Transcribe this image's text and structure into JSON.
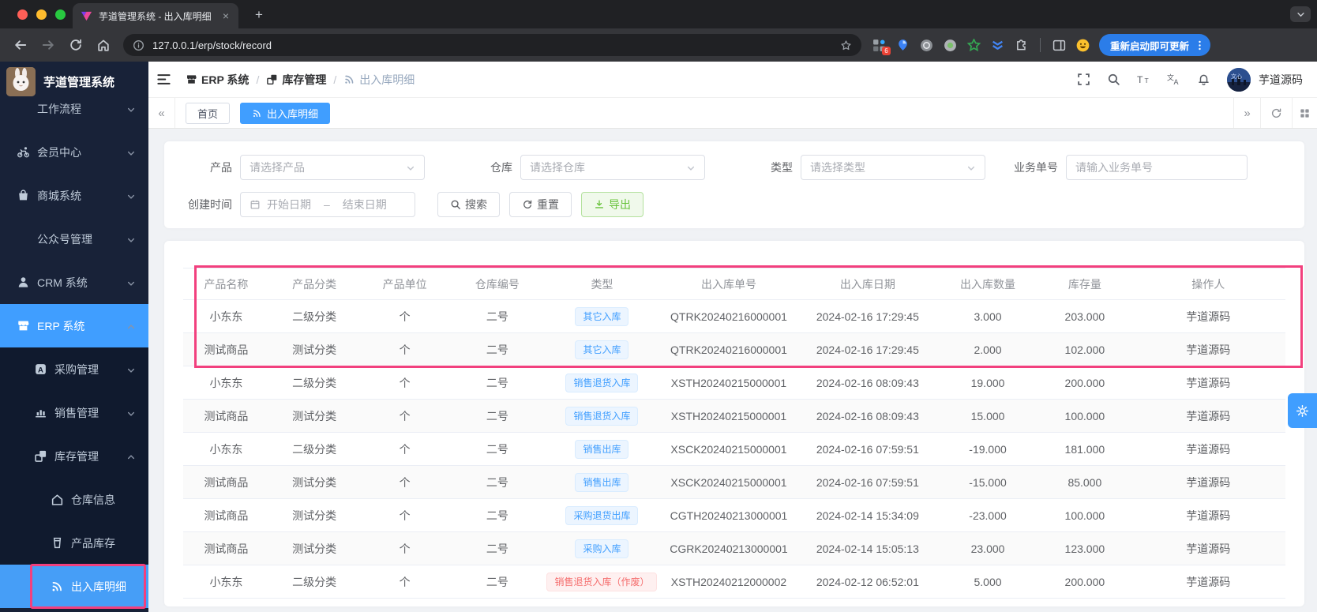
{
  "browser": {
    "tab_title": "芋道管理系统 - 出入库明细",
    "url": "127.0.0.1/erp/stock/record",
    "update_button": "重新启动即可更新",
    "extension_badge": "6"
  },
  "sidebar": {
    "app_title": "芋道管理系统",
    "items": [
      {
        "id": "workflow",
        "label": "工作流程",
        "icon": "",
        "chevron": "down",
        "level": 1
      },
      {
        "id": "member",
        "label": "会员中心",
        "icon": "member-icon",
        "chevron": "down",
        "level": 1
      },
      {
        "id": "mall",
        "label": "商城系统",
        "icon": "mall-icon",
        "chevron": "down",
        "level": 1
      },
      {
        "id": "mp",
        "label": "公众号管理",
        "icon": "",
        "chevron": "down",
        "level": 1
      },
      {
        "id": "crm",
        "label": "CRM 系统",
        "icon": "crm-icon",
        "chevron": "down",
        "level": 1
      },
      {
        "id": "erp",
        "label": "ERP 系统",
        "icon": "store-icon",
        "chevron": "up",
        "level": 1,
        "active": true
      },
      {
        "id": "purchase",
        "label": "采购管理",
        "icon": "purchase-icon",
        "chevron": "down",
        "level": 2
      },
      {
        "id": "sales",
        "label": "销售管理",
        "icon": "sales-icon",
        "chevron": "down",
        "level": 2
      },
      {
        "id": "inventory",
        "label": "库存管理",
        "icon": "boxes-icon",
        "chevron": "up",
        "level": 2
      },
      {
        "id": "warehouse-info",
        "label": "仓库信息",
        "icon": "home-icon",
        "level": 3
      },
      {
        "id": "product-stock",
        "label": "产品库存",
        "icon": "cup-icon",
        "level": 3
      },
      {
        "id": "stock-record",
        "label": "出入库明细",
        "icon": "signal-icon",
        "level": 3,
        "active": true,
        "annotated": true
      }
    ]
  },
  "header": {
    "breadcrumb": [
      {
        "label": "ERP 系统",
        "icon": "store-icon"
      },
      {
        "label": "库存管理",
        "icon": "boxes-icon"
      },
      {
        "label": "出入库明细",
        "icon": "signal-icon"
      }
    ],
    "user_name": "芋道源码"
  },
  "tags": [
    {
      "label": "首页",
      "active": false
    },
    {
      "label": "出入库明细",
      "icon": "signal-icon",
      "active": true
    }
  ],
  "filters": {
    "product": {
      "label": "产品",
      "placeholder": "请选择产品"
    },
    "warehouse": {
      "label": "仓库",
      "placeholder": "请选择仓库"
    },
    "type": {
      "label": "类型",
      "placeholder": "请选择类型"
    },
    "biz_no": {
      "label": "业务单号",
      "placeholder": "请输入业务单号"
    },
    "create_time": {
      "label": "创建时间",
      "start_placeholder": "开始日期",
      "separator": "–",
      "end_placeholder": "结束日期"
    },
    "search_button": "搜索",
    "reset_button": "重置",
    "export_button": "导出"
  },
  "table": {
    "columns": [
      "产品名称",
      "产品分类",
      "产品单位",
      "仓库编号",
      "类型",
      "出入库单号",
      "出入库日期",
      "出入库数量",
      "库存量",
      "操作人"
    ],
    "rows": [
      {
        "product": "小东东",
        "category": "二级分类",
        "unit": "个",
        "warehouse": "二号",
        "type": "其它入库",
        "type_style": "blue",
        "order_no": "QTRK20240216000001",
        "date": "2024-02-16 17:29:45",
        "qty": "3.000",
        "stock": "203.000",
        "operator": "芋道源码"
      },
      {
        "product": "测试商品",
        "category": "测试分类",
        "unit": "个",
        "warehouse": "二号",
        "type": "其它入库",
        "type_style": "blue",
        "order_no": "QTRK20240216000001",
        "date": "2024-02-16 17:29:45",
        "qty": "2.000",
        "stock": "102.000",
        "operator": "芋道源码"
      },
      {
        "product": "小东东",
        "category": "二级分类",
        "unit": "个",
        "warehouse": "二号",
        "type": "销售退货入库",
        "type_style": "blue",
        "order_no": "XSTH20240215000001",
        "date": "2024-02-16 08:09:43",
        "qty": "19.000",
        "stock": "200.000",
        "operator": "芋道源码"
      },
      {
        "product": "测试商品",
        "category": "测试分类",
        "unit": "个",
        "warehouse": "二号",
        "type": "销售退货入库",
        "type_style": "blue",
        "order_no": "XSTH20240215000001",
        "date": "2024-02-16 08:09:43",
        "qty": "15.000",
        "stock": "100.000",
        "operator": "芋道源码"
      },
      {
        "product": "小东东",
        "category": "二级分类",
        "unit": "个",
        "warehouse": "二号",
        "type": "销售出库",
        "type_style": "blue",
        "order_no": "XSCK20240215000001",
        "date": "2024-02-16 07:59:51",
        "qty": "-19.000",
        "stock": "181.000",
        "operator": "芋道源码"
      },
      {
        "product": "测试商品",
        "category": "测试分类",
        "unit": "个",
        "warehouse": "二号",
        "type": "销售出库",
        "type_style": "blue",
        "order_no": "XSCK20240215000001",
        "date": "2024-02-16 07:59:51",
        "qty": "-15.000",
        "stock": "85.000",
        "operator": "芋道源码"
      },
      {
        "product": "测试商品",
        "category": "测试分类",
        "unit": "个",
        "warehouse": "二号",
        "type": "采购退货出库",
        "type_style": "blue",
        "order_no": "CGTH20240213000001",
        "date": "2024-02-14 15:34:09",
        "qty": "-23.000",
        "stock": "100.000",
        "operator": "芋道源码"
      },
      {
        "product": "测试商品",
        "category": "测试分类",
        "unit": "个",
        "warehouse": "二号",
        "type": "采购入库",
        "type_style": "blue",
        "order_no": "CGRK20240213000001",
        "date": "2024-02-14 15:05:13",
        "qty": "23.000",
        "stock": "123.000",
        "operator": "芋道源码"
      },
      {
        "product": "小东东",
        "category": "二级分类",
        "unit": "个",
        "warehouse": "二号",
        "type": "销售退货入库（作废）",
        "type_style": "red",
        "order_no": "XSTH20240212000002",
        "date": "2024-02-12 06:52:01",
        "qty": "5.000",
        "stock": "200.000",
        "operator": "芋道源码"
      }
    ]
  },
  "colors": {
    "primary": "#409eff",
    "annotation": "#f2407e",
    "badge_blue_text": "#409eff",
    "badge_blue_bg": "#ecf5ff",
    "badge_red_text": "#f56c6c",
    "badge_red_bg": "#fef0f0",
    "success": "#67c23a"
  }
}
